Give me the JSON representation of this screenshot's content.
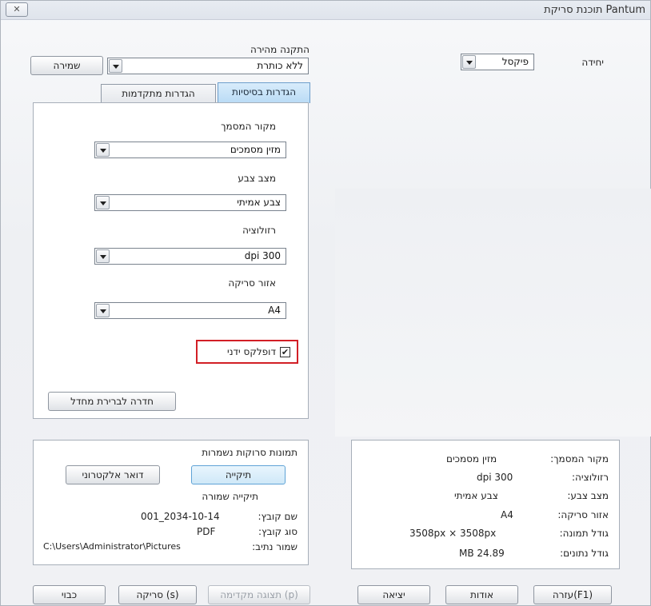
{
  "window": {
    "title": "תוכנת סריקת Pantum",
    "close_glyph": "✕"
  },
  "unit": {
    "label": "יחידה",
    "value": "פיקסל"
  },
  "preset": {
    "label": "התקנה מהירה",
    "value": "ללא כותרת",
    "save_label": "שמירה"
  },
  "tabs": {
    "basic": "הגדרות בסיסיות",
    "advanced": "הגדרות מתקדמות"
  },
  "basic": {
    "source_label": "מקור המסמך",
    "source_value": "מזין מסמכים",
    "color_label": "מצב צבע",
    "color_value": "צבע אמיתי",
    "resolution_label": "רזולוציה",
    "resolution_value": "dpi 300",
    "area_label": "אזור סריקה",
    "area_value": "A4",
    "duplex_label": "דופלקס ידני",
    "duplex_checked": true,
    "restore_label": "חדרה לברירת מחדל"
  },
  "saved": {
    "heading": "תמונות סרוקות נשמרות",
    "folder_button": "תיקייה",
    "email_button": "דואר אלקטרוני",
    "saved_folder_label": "תיקייה שמורה",
    "filename_key": "שם קובץ:",
    "filename_value": "001_2034-10-14",
    "filetype_key": "סוג קובץ:",
    "filetype_value": "PDF",
    "path_key": "שמור נתיב:",
    "path_value": "C:\\Users\\Administrator\\Pictures"
  },
  "info": {
    "source_key": "מקור המסמך:",
    "source_value": "מזין מסמכים",
    "resolution_key": "רזולוציה:",
    "resolution_value": "dpi 300",
    "color_key": "מצב צבע:",
    "color_value": "צבע אמיתי",
    "area_key": "אזור סריקה:",
    "area_value": "A4",
    "imagesize_key": "גודל תמונה:",
    "imagesize_value": "3508px × 3508px",
    "datasize_key": "גודל נתונים:",
    "datasize_value": "MB 24.89"
  },
  "bottom": {
    "off_label": "כבוי",
    "scan_label": "סריקה (s)",
    "preview_label": "תצוגה מקדימה (p)",
    "exit_label": "יציאה",
    "about_label": "אודות",
    "help_label": "עזרה(F1)"
  }
}
